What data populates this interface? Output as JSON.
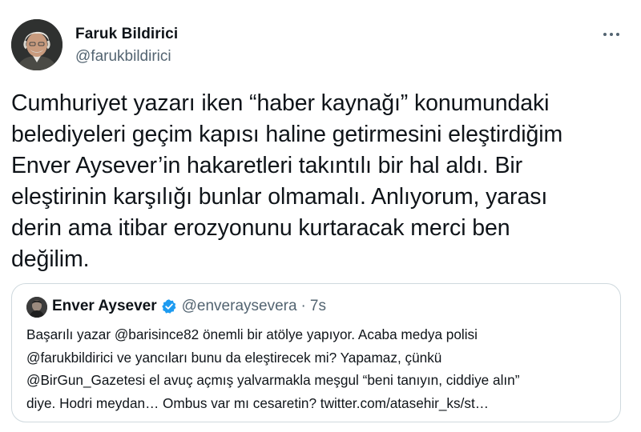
{
  "tweet": {
    "author_name": "Faruk Bildirici",
    "author_handle": "@farukbildirici",
    "more_icon": "more-horizontal-icon",
    "text_lines": [
      "Cumhuriyet yazarı iken “haber kaynağı” konumundaki",
      "belediyeleri geçim kapısı haline getirmesini eleştirdiğim",
      "Enver Aysever’in hakaretleri takıntılı bir hal aldı. Bir",
      "eleştirinin karşılığı bunlar olmamalı. Anlıyorum, yarası",
      "derin ama itibar erozyonunu kurtaracak merci ben",
      "değilim."
    ]
  },
  "quoted": {
    "author_name": "Enver Aysever",
    "verified_icon": "verified-badge-icon",
    "author_handle": "@enveraysevera",
    "separator": "·",
    "time": "7s",
    "text_lines": [
      "Başarılı yazar @barisince82 önemli bir atölye yapıyor. Acaba medya polisi",
      "@farukbildirici ve yancıları bunu da eleştirecek mi? Yapamaz, çünkü",
      "@BirGun_Gazetesi el avuç açmış yalvarmakla meşgul “beni tanıyın, ciddiye alın”",
      "diye. Hodri meydan… Ombus var mı cesaretin? twitter.com/atasehir_ks/st…"
    ]
  },
  "colors": {
    "text": "#0f1419",
    "secondary": "#536471",
    "border": "#cfd9de",
    "verified": "#1d9bf0"
  }
}
